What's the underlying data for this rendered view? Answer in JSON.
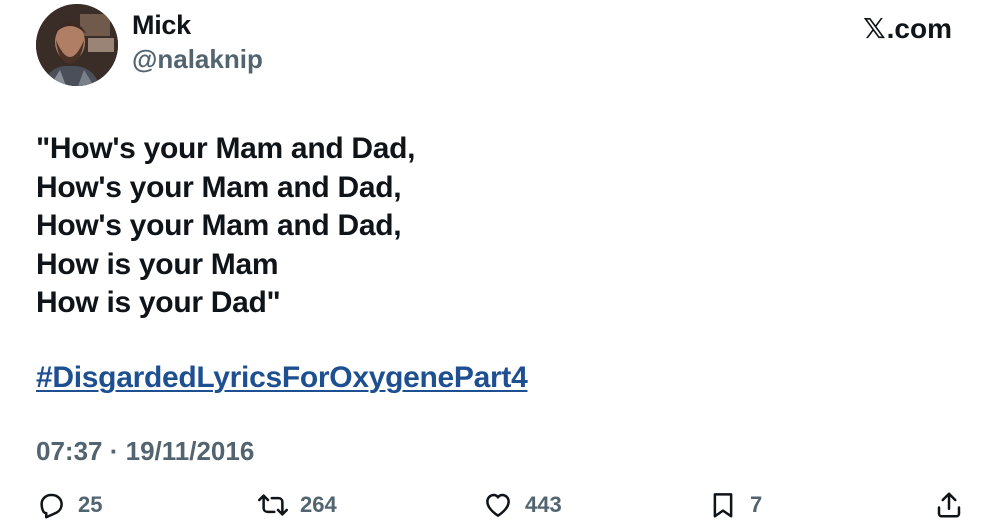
{
  "author": {
    "display_name": "Mick",
    "handle": "@nalaknip",
    "avatar_icon": "user-avatar-photo"
  },
  "brand": {
    "x_mark": "𝕏",
    "label": ".com"
  },
  "tweet": {
    "lines": [
      "\"How's your Mam and Dad,",
      "How's your Mam and Dad,",
      "How's your Mam and Dad,",
      "How is your Mam",
      "How is your Dad\""
    ],
    "hashtag": "#DisgardedLyricsForOxygenePart4",
    "timestamp": "07:37 · 19/11/2016"
  },
  "actions": {
    "reply": {
      "icon": "reply-icon",
      "count": "25"
    },
    "retweet": {
      "icon": "retweet-icon",
      "count": "264"
    },
    "like": {
      "icon": "heart-icon",
      "count": "443"
    },
    "bookmark": {
      "icon": "bookmark-icon",
      "count": "7"
    },
    "share": {
      "icon": "share-icon"
    }
  },
  "colors": {
    "text": "#0f1419",
    "secondary": "#536471",
    "link": "#1d4f91",
    "background": "#ffffff"
  }
}
